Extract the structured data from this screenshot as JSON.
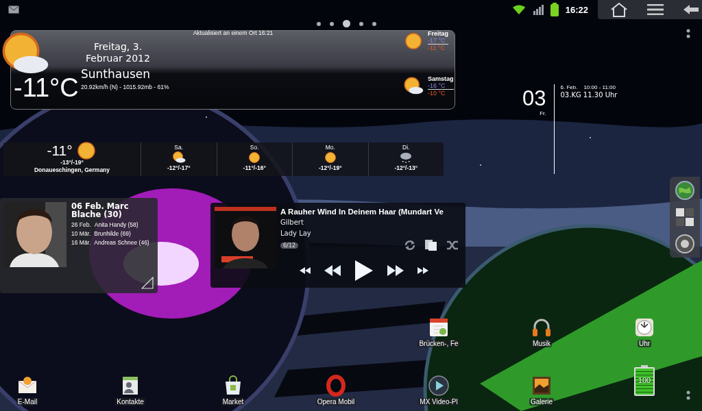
{
  "status_bar": {
    "time": "16:22"
  },
  "page_indicator": [
    {
      "selected": false
    },
    {
      "selected": false
    },
    {
      "selected": true
    },
    {
      "selected": false
    },
    {
      "selected": false
    }
  ],
  "weather_widget": {
    "updated": "Aktualisiert an einem Ort 16:21",
    "date_line_1": "Freitag, 3.",
    "date_line_2": "Februar 2012",
    "temperature": "-11°C",
    "location": "Sunthausen",
    "details": "20.92km/h (N)  -  1015.92mb  -  61%",
    "kind": "partly_cloudy",
    "forecast": [
      {
        "day": "Freitag",
        "low": "-17 °C",
        "high": "-11 °C",
        "kind": "sunny"
      },
      {
        "day": "Samstag",
        "low": "-16 °C",
        "high": "-10 °C",
        "kind": "partly_cloudy"
      }
    ]
  },
  "forecast_strip": {
    "current": {
      "temperature": "-11°",
      "range": "-13°/-19°",
      "location": "Donaueschingen, Germany",
      "kind": "sunny"
    },
    "days": [
      {
        "day": "Sa.",
        "range": "-12°/-17°",
        "kind": "partly_cloudy"
      },
      {
        "day": "So.",
        "range": "-11°/-16°",
        "kind": "sunny"
      },
      {
        "day": "Mo.",
        "range": "-12°/-19°",
        "kind": "sunny"
      },
      {
        "day": "Di.",
        "range": "-12°/-13°",
        "kind": "snow"
      }
    ]
  },
  "calendar_widget": {
    "day": "03",
    "weekday": "Fr.",
    "events": [
      {
        "date": "6. Feb.",
        "time": "10:00 - 11:00",
        "title": "03.KG 11.30 Uhr"
      }
    ]
  },
  "birthday_widget": {
    "headline": "06 Feb.   Marc Blache (30)",
    "upcoming": [
      {
        "date": "26 Feb.",
        "name": "Anita Handy (58)"
      },
      {
        "date": "10 Mär.",
        "name": "Brunhilde (69)"
      },
      {
        "date": "16 Mär.",
        "name": "Andreas Schnee (46)"
      }
    ]
  },
  "music_widget": {
    "title": "A Rauher Wind In Deinem Haar (Mundart Ve",
    "artist": "Gilbert",
    "album": "Lady Lay",
    "track": "6/12"
  },
  "apps": [
    {
      "label": "Brücken-, Fe"
    },
    {
      "label": "Musik"
    },
    {
      "label": "Uhr"
    },
    {
      "label": "E-Mail"
    },
    {
      "label": "Kontakte"
    },
    {
      "label": "Market"
    },
    {
      "label": "Opera Mobil"
    },
    {
      "label": "MX Video-Pl"
    },
    {
      "label": "Galerie"
    }
  ],
  "battery_widget": {
    "label": "100",
    "level": 1
  }
}
